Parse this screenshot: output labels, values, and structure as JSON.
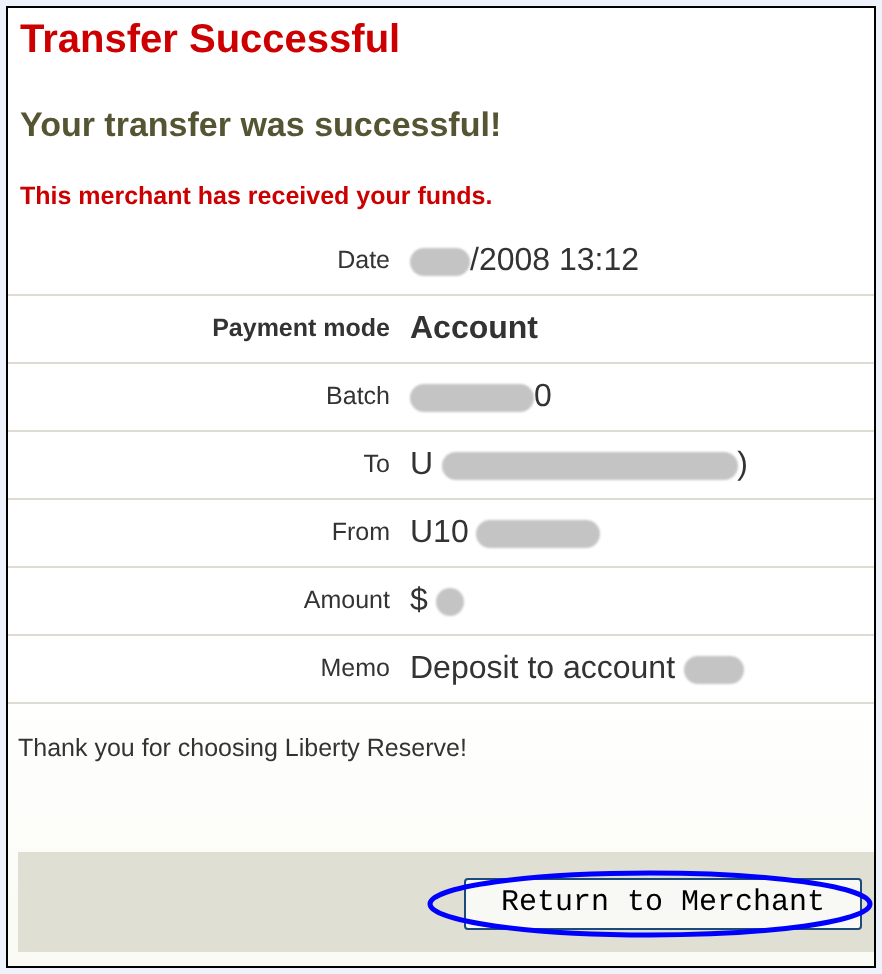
{
  "title": "Transfer Successful",
  "heading": "Your transfer was successful!",
  "notice": "This merchant has received your funds.",
  "details": [
    {
      "label": "Date",
      "emphasis": false,
      "parts": [
        {
          "kind": "smudge"
        },
        {
          "kind": "text",
          "text": "/2008 13:12"
        }
      ]
    },
    {
      "label": "Payment mode",
      "emphasis": true,
      "parts": [
        {
          "kind": "text",
          "text": "Account"
        }
      ]
    },
    {
      "label": "Batch",
      "emphasis": false,
      "parts": [
        {
          "kind": "bar"
        },
        {
          "kind": "text",
          "text": "0"
        }
      ]
    },
    {
      "label": "To",
      "emphasis": false,
      "parts": [
        {
          "kind": "text",
          "text": "U"
        },
        {
          "kind": "band"
        },
        {
          "kind": "text",
          "text": ")"
        }
      ]
    },
    {
      "label": "From",
      "emphasis": false,
      "parts": [
        {
          "kind": "text",
          "text": "U10"
        },
        {
          "kind": "bar"
        }
      ]
    },
    {
      "label": "Amount",
      "emphasis": false,
      "parts": [
        {
          "kind": "text",
          "text": "$"
        },
        {
          "kind": "blot"
        }
      ]
    },
    {
      "label": "Memo",
      "emphasis": false,
      "parts": [
        {
          "kind": "text",
          "text": "Deposit to account"
        },
        {
          "kind": "smudge"
        }
      ]
    }
  ],
  "thanks": "Thank you for choosing Liberty Reserve!",
  "button": {
    "label": "Return to Merchant",
    "highlight": {
      "color": "#0000ff"
    }
  }
}
